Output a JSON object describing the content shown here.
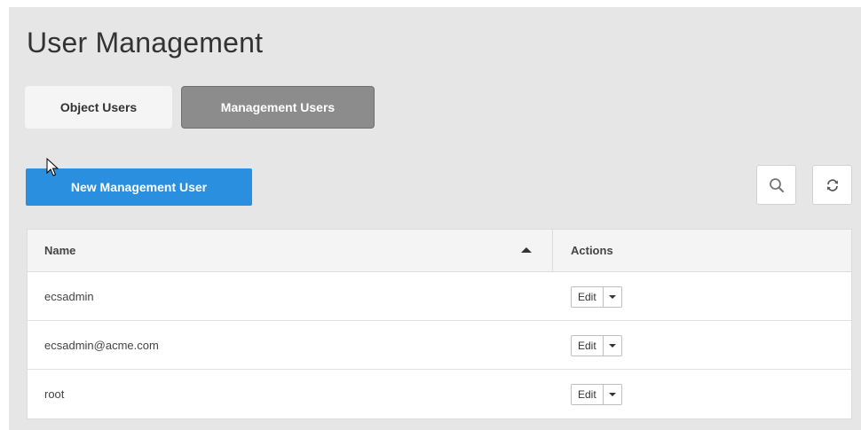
{
  "page": {
    "title": "User Management"
  },
  "tabs": [
    {
      "label": "Object Users",
      "active": false
    },
    {
      "label": "Management Users",
      "active": true
    }
  ],
  "toolbar": {
    "new_button_label": "New Management User",
    "search_icon": "search-icon",
    "refresh_icon": "refresh-icon"
  },
  "table": {
    "columns": [
      "Name",
      "Actions"
    ],
    "sort": {
      "column": "Name",
      "direction": "ascending"
    },
    "rows": [
      {
        "name": "ecsadmin",
        "action_label": "Edit"
      },
      {
        "name": "ecsadmin@acme.com",
        "action_label": "Edit"
      },
      {
        "name": "root",
        "action_label": "Edit"
      }
    ]
  },
  "colors": {
    "panel_bg": "#e6e6e6",
    "primary": "#2a8fde",
    "active_tab": "#8c8c8c"
  }
}
